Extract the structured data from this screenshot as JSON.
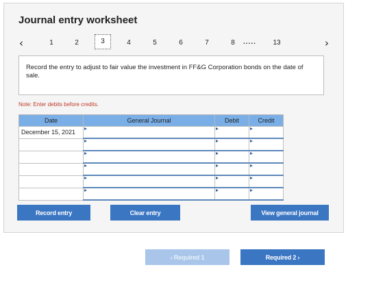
{
  "title": "Journal entry worksheet",
  "pager": {
    "prev_icon": "‹",
    "next_icon": "›",
    "pages": [
      "1",
      "2",
      "3",
      "4",
      "5",
      "6",
      "7",
      "8"
    ],
    "ellipsis": ".....",
    "last": "13",
    "active": "3"
  },
  "instruction": "Record the entry to adjust to fair value the investment in FF&G Corporation bonds on the date of sale.",
  "note": "Note: Enter debits before credits.",
  "table": {
    "headers": [
      "Date",
      "General Journal",
      "Debit",
      "Credit"
    ],
    "rows": [
      {
        "date": "December 15, 2021"
      },
      {
        "date": ""
      },
      {
        "date": ""
      },
      {
        "date": ""
      },
      {
        "date": ""
      },
      {
        "date": ""
      }
    ]
  },
  "buttons": {
    "record": "Record entry",
    "clear": "Clear entry",
    "view": "View general journal"
  },
  "nav": {
    "prev": "‹  Required 1",
    "next": "Required 2  ›"
  },
  "colors": {
    "primary": "#3b76c3",
    "header": "#79aee6",
    "note": "#c0392b",
    "disabled": "#a9c6ea"
  }
}
